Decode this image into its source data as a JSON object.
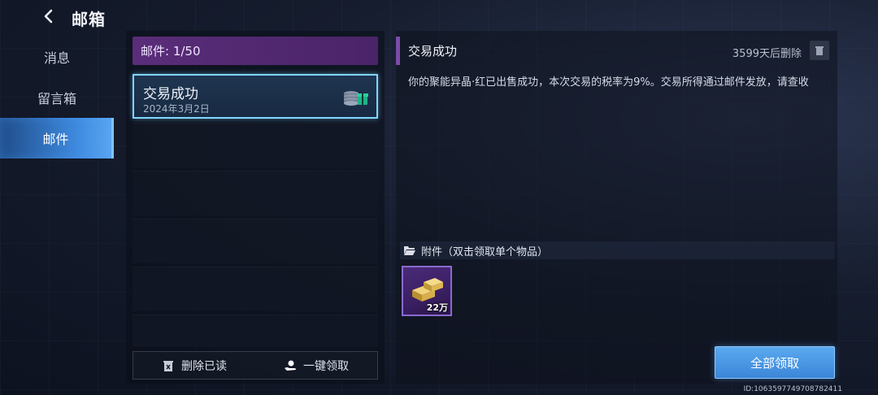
{
  "header": {
    "title": "邮箱"
  },
  "sidebar": {
    "items": [
      {
        "label": "消息",
        "active": false
      },
      {
        "label": "留言箱",
        "active": false
      },
      {
        "label": "邮件",
        "active": true
      }
    ]
  },
  "mail_list": {
    "header": "邮件: 1/50",
    "items": [
      {
        "subject": "交易成功",
        "date": "2024年3月2日"
      }
    ],
    "footer": {
      "delete_read": "删除已读",
      "claim_one_key": "一键领取"
    }
  },
  "detail": {
    "title": "交易成功",
    "expire": "3599天后删除",
    "body": "你的聚能异晶·红已出售成功，本次交易的税率为9%。交易所得通过邮件发放，请查收",
    "attachments_label": "附件（双击领取单个物品）",
    "attachments": [
      {
        "count": "22万",
        "icon": "gold-bars-icon"
      }
    ],
    "claim_all": "全部领取"
  },
  "footer": {
    "uid": "ID:1063597749708782411"
  },
  "colors": {
    "accent_blue": "#3f8be0",
    "list_header_purple": "#5a2d7a",
    "selected_border": "#7fd6ff"
  }
}
